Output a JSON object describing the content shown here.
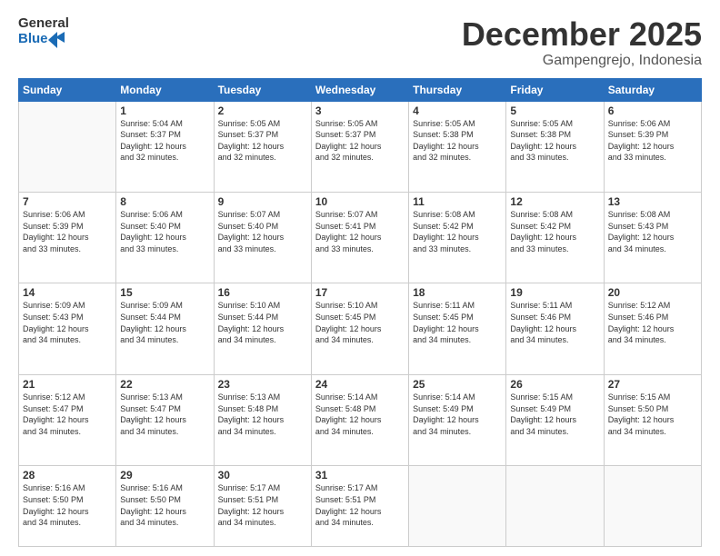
{
  "logo": {
    "text_general": "General",
    "text_blue": "Blue"
  },
  "header": {
    "month": "December 2025",
    "location": "Gampengrejo, Indonesia"
  },
  "weekdays": [
    "Sunday",
    "Monday",
    "Tuesday",
    "Wednesday",
    "Thursday",
    "Friday",
    "Saturday"
  ],
  "weeks": [
    [
      {
        "day": "",
        "info": ""
      },
      {
        "day": "1",
        "info": "Sunrise: 5:04 AM\nSunset: 5:37 PM\nDaylight: 12 hours\nand 32 minutes."
      },
      {
        "day": "2",
        "info": "Sunrise: 5:05 AM\nSunset: 5:37 PM\nDaylight: 12 hours\nand 32 minutes."
      },
      {
        "day": "3",
        "info": "Sunrise: 5:05 AM\nSunset: 5:37 PM\nDaylight: 12 hours\nand 32 minutes."
      },
      {
        "day": "4",
        "info": "Sunrise: 5:05 AM\nSunset: 5:38 PM\nDaylight: 12 hours\nand 32 minutes."
      },
      {
        "day": "5",
        "info": "Sunrise: 5:05 AM\nSunset: 5:38 PM\nDaylight: 12 hours\nand 33 minutes."
      },
      {
        "day": "6",
        "info": "Sunrise: 5:06 AM\nSunset: 5:39 PM\nDaylight: 12 hours\nand 33 minutes."
      }
    ],
    [
      {
        "day": "7",
        "info": "Sunrise: 5:06 AM\nSunset: 5:39 PM\nDaylight: 12 hours\nand 33 minutes."
      },
      {
        "day": "8",
        "info": "Sunrise: 5:06 AM\nSunset: 5:40 PM\nDaylight: 12 hours\nand 33 minutes."
      },
      {
        "day": "9",
        "info": "Sunrise: 5:07 AM\nSunset: 5:40 PM\nDaylight: 12 hours\nand 33 minutes."
      },
      {
        "day": "10",
        "info": "Sunrise: 5:07 AM\nSunset: 5:41 PM\nDaylight: 12 hours\nand 33 minutes."
      },
      {
        "day": "11",
        "info": "Sunrise: 5:08 AM\nSunset: 5:42 PM\nDaylight: 12 hours\nand 33 minutes."
      },
      {
        "day": "12",
        "info": "Sunrise: 5:08 AM\nSunset: 5:42 PM\nDaylight: 12 hours\nand 33 minutes."
      },
      {
        "day": "13",
        "info": "Sunrise: 5:08 AM\nSunset: 5:43 PM\nDaylight: 12 hours\nand 34 minutes."
      }
    ],
    [
      {
        "day": "14",
        "info": "Sunrise: 5:09 AM\nSunset: 5:43 PM\nDaylight: 12 hours\nand 34 minutes."
      },
      {
        "day": "15",
        "info": "Sunrise: 5:09 AM\nSunset: 5:44 PM\nDaylight: 12 hours\nand 34 minutes."
      },
      {
        "day": "16",
        "info": "Sunrise: 5:10 AM\nSunset: 5:44 PM\nDaylight: 12 hours\nand 34 minutes."
      },
      {
        "day": "17",
        "info": "Sunrise: 5:10 AM\nSunset: 5:45 PM\nDaylight: 12 hours\nand 34 minutes."
      },
      {
        "day": "18",
        "info": "Sunrise: 5:11 AM\nSunset: 5:45 PM\nDaylight: 12 hours\nand 34 minutes."
      },
      {
        "day": "19",
        "info": "Sunrise: 5:11 AM\nSunset: 5:46 PM\nDaylight: 12 hours\nand 34 minutes."
      },
      {
        "day": "20",
        "info": "Sunrise: 5:12 AM\nSunset: 5:46 PM\nDaylight: 12 hours\nand 34 minutes."
      }
    ],
    [
      {
        "day": "21",
        "info": "Sunrise: 5:12 AM\nSunset: 5:47 PM\nDaylight: 12 hours\nand 34 minutes."
      },
      {
        "day": "22",
        "info": "Sunrise: 5:13 AM\nSunset: 5:47 PM\nDaylight: 12 hours\nand 34 minutes."
      },
      {
        "day": "23",
        "info": "Sunrise: 5:13 AM\nSunset: 5:48 PM\nDaylight: 12 hours\nand 34 minutes."
      },
      {
        "day": "24",
        "info": "Sunrise: 5:14 AM\nSunset: 5:48 PM\nDaylight: 12 hours\nand 34 minutes."
      },
      {
        "day": "25",
        "info": "Sunrise: 5:14 AM\nSunset: 5:49 PM\nDaylight: 12 hours\nand 34 minutes."
      },
      {
        "day": "26",
        "info": "Sunrise: 5:15 AM\nSunset: 5:49 PM\nDaylight: 12 hours\nand 34 minutes."
      },
      {
        "day": "27",
        "info": "Sunrise: 5:15 AM\nSunset: 5:50 PM\nDaylight: 12 hours\nand 34 minutes."
      }
    ],
    [
      {
        "day": "28",
        "info": "Sunrise: 5:16 AM\nSunset: 5:50 PM\nDaylight: 12 hours\nand 34 minutes."
      },
      {
        "day": "29",
        "info": "Sunrise: 5:16 AM\nSunset: 5:50 PM\nDaylight: 12 hours\nand 34 minutes."
      },
      {
        "day": "30",
        "info": "Sunrise: 5:17 AM\nSunset: 5:51 PM\nDaylight: 12 hours\nand 34 minutes."
      },
      {
        "day": "31",
        "info": "Sunrise: 5:17 AM\nSunset: 5:51 PM\nDaylight: 12 hours\nand 34 minutes."
      },
      {
        "day": "",
        "info": ""
      },
      {
        "day": "",
        "info": ""
      },
      {
        "day": "",
        "info": ""
      }
    ]
  ]
}
